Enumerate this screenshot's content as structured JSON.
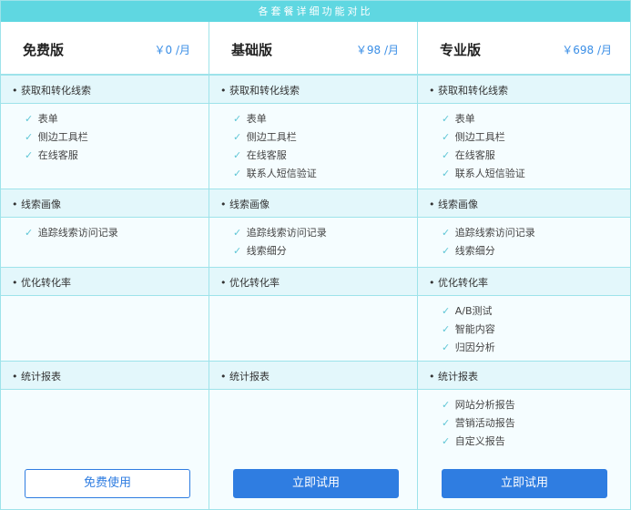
{
  "title": "各套餐详细功能对比",
  "plans": [
    {
      "name": "免费版",
      "price": "￥0 /月",
      "button": "免费使用",
      "sections": [
        {
          "title": "• 获取和转化线索",
          "items": [
            "✓ 表单",
            "✓ 侧边工具栏",
            "✓ 在线客服"
          ]
        },
        {
          "title": "• 线索画像",
          "items": [
            "✓ 追踪线索访问记录"
          ]
        },
        {
          "title": "• 优化转化率",
          "items": []
        },
        {
          "title": "• 统计报表",
          "items": []
        }
      ]
    },
    {
      "name": "基础版",
      "price": "￥98 /月",
      "button": "立即试用",
      "sections": [
        {
          "title": "• 获取和转化线索",
          "items": [
            "✓ 表单",
            "✓ 侧边工具栏",
            "✓ 在线客服",
            "✓ 联系人短信验证"
          ]
        },
        {
          "title": "• 线索画像",
          "items": [
            "✓ 追踪线索访问记录",
            "✓ 线索细分"
          ]
        },
        {
          "title": "• 优化转化率",
          "items": []
        },
        {
          "title": "• 统计报表",
          "items": []
        }
      ]
    },
    {
      "name": "专业版",
      "price": "￥698 /月",
      "button": "立即试用",
      "sections": [
        {
          "title": "• 获取和转化线索",
          "items": [
            "✓ 表单",
            "✓ 侧边工具栏",
            "✓ 在线客服",
            "✓ 联系人短信验证"
          ]
        },
        {
          "title": "• 线索画像",
          "items": [
            "✓ 追踪线索访问记录",
            "✓ 线索细分"
          ]
        },
        {
          "title": "• 优化转化率",
          "items": [
            "✓ A/B测试",
            "✓ 智能内容",
            "✓ 归因分析"
          ]
        },
        {
          "title": "• 统计报表",
          "items": [
            "✓ 网站分析报告",
            "✓ 营销活动报告",
            "✓ 自定义报告"
          ]
        }
      ]
    }
  ]
}
